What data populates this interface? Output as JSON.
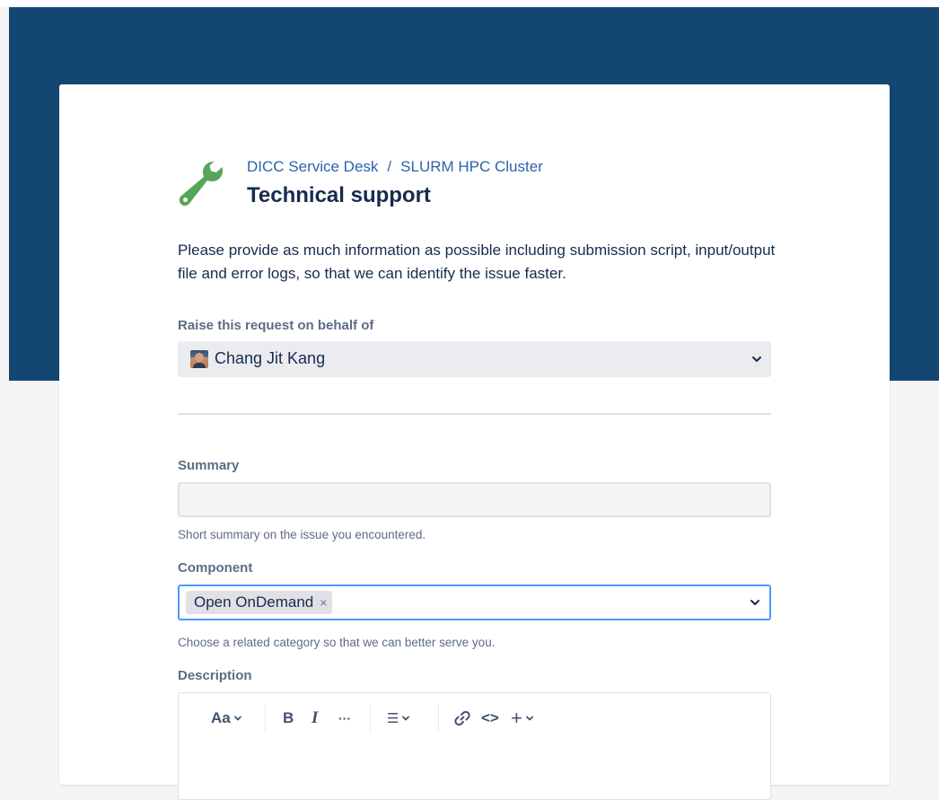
{
  "breadcrumb": {
    "portal": "DICC Service Desk",
    "separator": "/",
    "project": "SLURM HPC Cluster"
  },
  "request_type": {
    "title": "Technical support",
    "icon": "wrench-icon",
    "icon_color": "#57a55a"
  },
  "intro_text": "Please provide as much information as possible including submission script, input/output file and error logs, so that we can identify the issue faster.",
  "behalf": {
    "label": "Raise this request on behalf of",
    "value": "Chang Jit Kang"
  },
  "summary": {
    "label": "Summary",
    "value": "",
    "help": "Short summary on the issue you encountered."
  },
  "component": {
    "label": "Component",
    "selected": [
      "Open OnDemand"
    ],
    "remove_glyph": "×",
    "help": "Choose a related category so that we can better serve you."
  },
  "description": {
    "label": "Description",
    "toolbar": {
      "text_style": "Aa",
      "bold": "B",
      "italic": "I",
      "more": "···",
      "list": "☰",
      "link_icon": "link-icon",
      "code": "<>",
      "insert": "+"
    }
  },
  "colors": {
    "banner": "#134671",
    "link": "#2a64a8",
    "focus_border": "#4c9aff"
  }
}
